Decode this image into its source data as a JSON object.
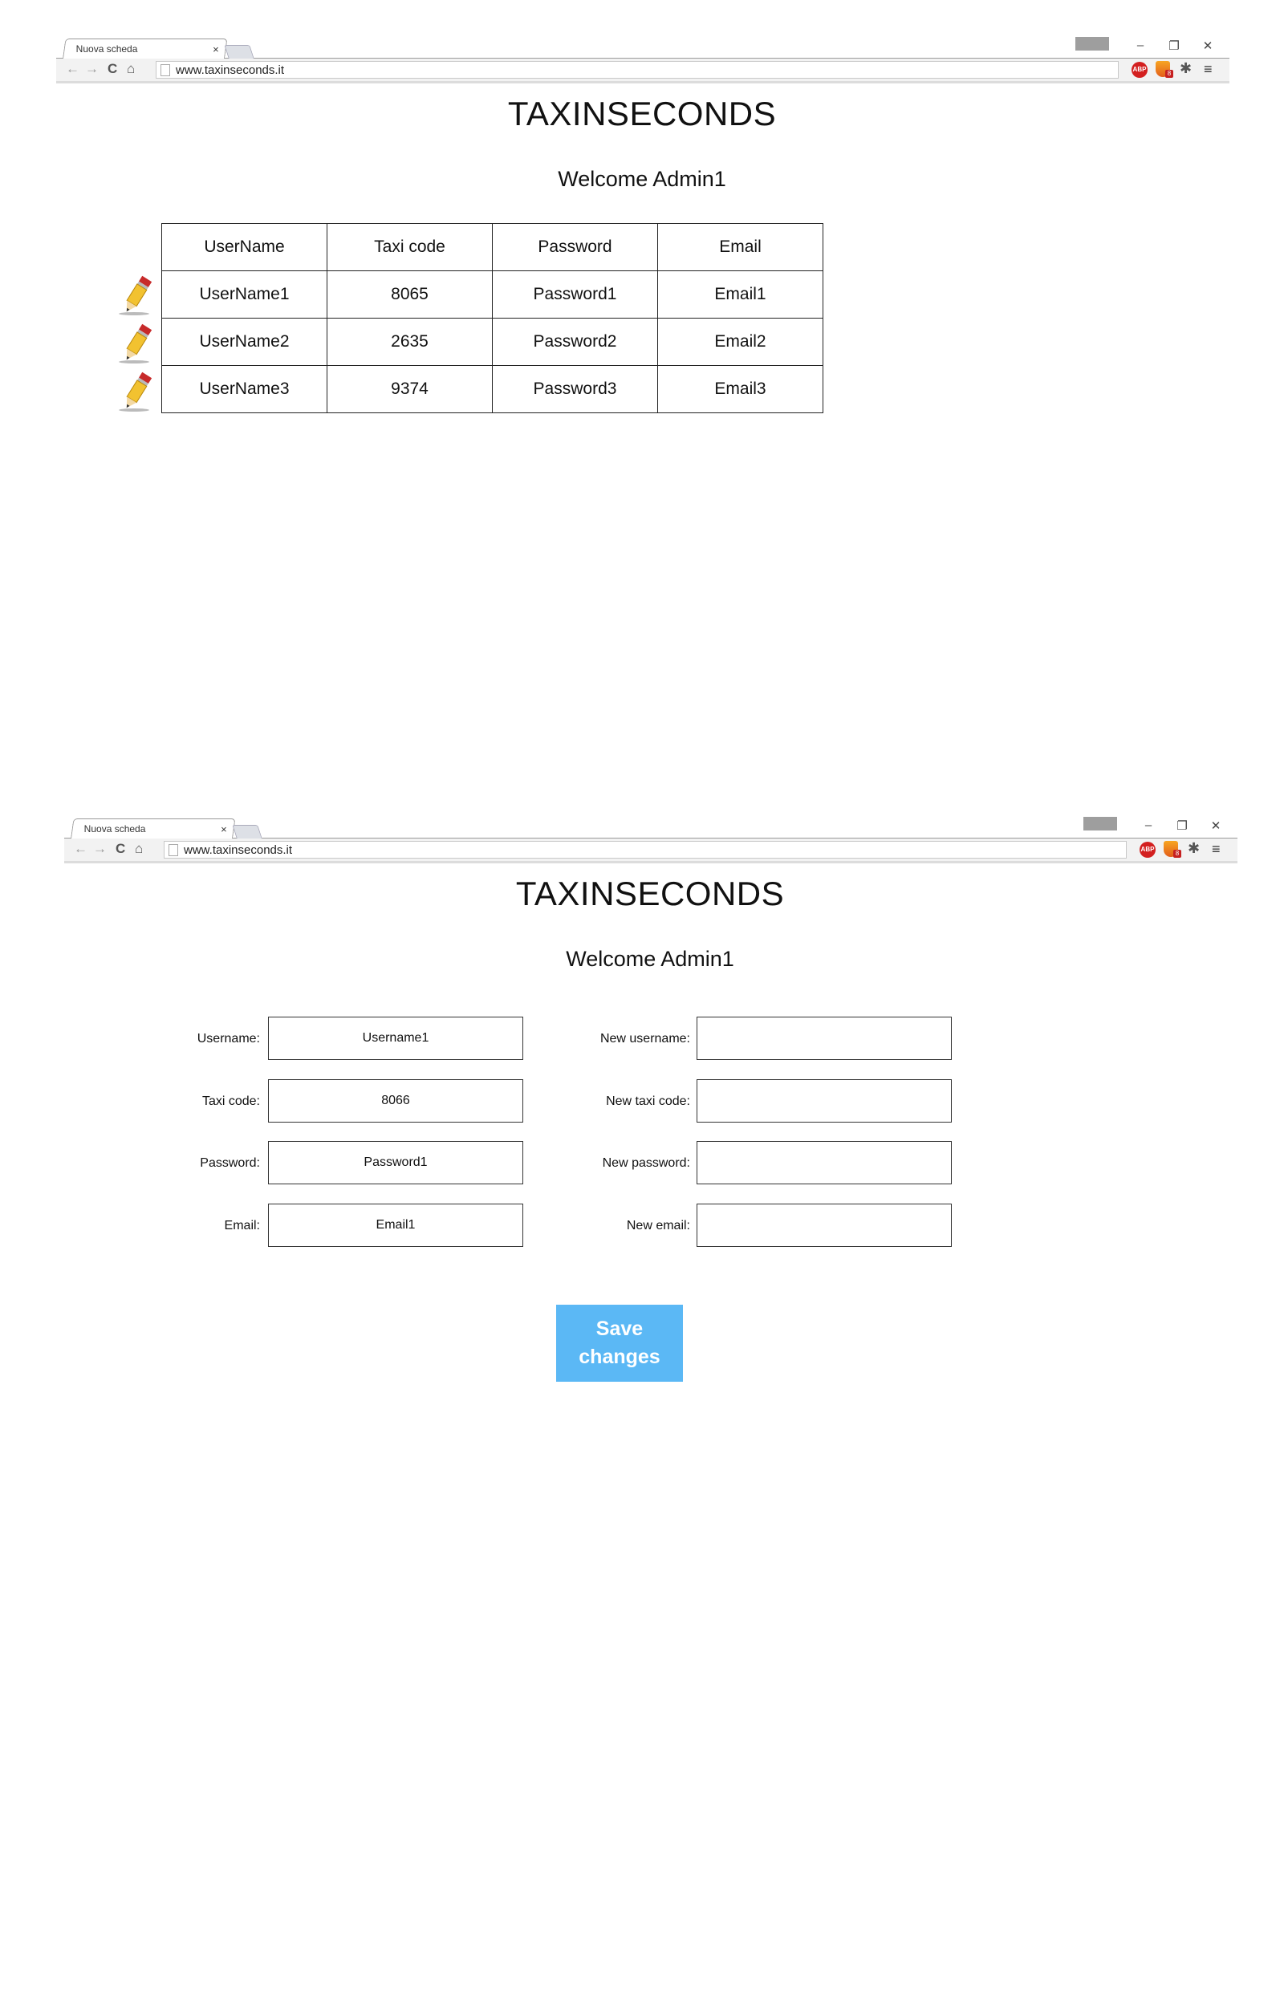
{
  "browser": {
    "tab_title": "Nuova scheda",
    "tab_close": "×",
    "url": "www.taxinseconds.it",
    "ext_abp": "ABP",
    "ext_badge": "8",
    "window_controls": {
      "minimize": "–",
      "restore": "❐",
      "close": "✕"
    },
    "nav": {
      "back": "←",
      "forward": "→",
      "reload": "C",
      "home": "⌂",
      "menu": "≡"
    }
  },
  "app_title": "TAXINSECONDS",
  "welcome": "Welcome Admin1",
  "users_table": {
    "headers": [
      "UserName",
      "Taxi code",
      "Password",
      "Email"
    ],
    "rows": [
      [
        "UserName1",
        "8065",
        "Password1",
        "Email1"
      ],
      [
        "UserName2",
        "2635",
        "Password2",
        "Email2"
      ],
      [
        "UserName3",
        "9374",
        "Password3",
        "Email3"
      ]
    ]
  },
  "edit_form": {
    "current": {
      "username_label": "Username:",
      "username_value": "Username1",
      "taxi_code_label": "Taxi code:",
      "taxi_code_value": "8066",
      "password_label": "Password:",
      "password_value": "Password1",
      "email_label": "Email:",
      "email_value": "Email1"
    },
    "new": {
      "username_label": "New username:",
      "username_value": "",
      "taxi_code_label": "New taxi code:",
      "taxi_code_value": "",
      "password_label": "New password:",
      "password_value": "",
      "email_label": "New email:",
      "email_value": ""
    },
    "save_button": "Save changes"
  },
  "colors": {
    "save_button": "#5bb8f5",
    "abp_red": "#d32020"
  }
}
